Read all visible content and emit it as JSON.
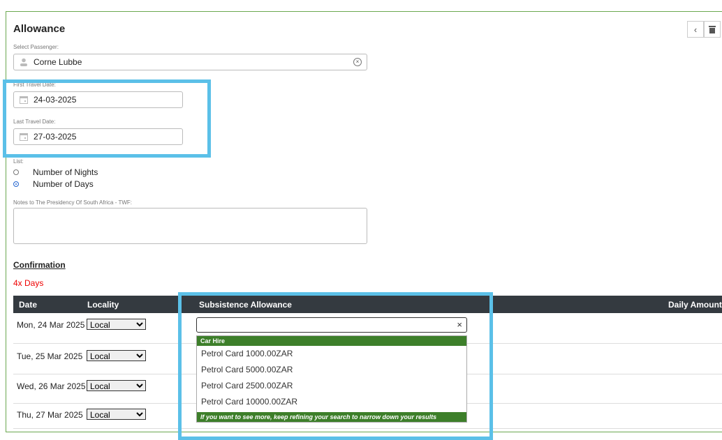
{
  "form": {
    "title": "Allowance",
    "passenger_label": "Select Passenger:",
    "passenger_value": "Corne Lubbe",
    "first_date_label": "First Travel Date:",
    "first_date_value": "24-03-2025",
    "last_date_label": "Last Travel Date:",
    "last_date_value": "27-03-2025",
    "list_label": "List:",
    "radio_nights": "Number of Nights",
    "radio_days": "Number of Days",
    "notes_label": "Notes to The Presidency Of South Africa - TWF:",
    "confirmation": "Confirmation",
    "days_count": "4x Days"
  },
  "table": {
    "headers": {
      "date": "Date",
      "locality": "Locality",
      "subsistence": "Subsistence Allowance",
      "daily": "Daily Amount"
    },
    "rows": [
      {
        "date": "Mon, 24 Mar 2025",
        "locality": "Local"
      },
      {
        "date": "Tue, 25 Mar 2025",
        "locality": "Local"
      },
      {
        "date": "Wed, 26 Mar 2025",
        "locality": "Local"
      },
      {
        "date": "Thu, 27 Mar 2025",
        "locality": "Local"
      }
    ]
  },
  "dropdown": {
    "group": "Car Hire",
    "options": [
      "Petrol Card 1000.00ZAR",
      "Petrol Card 5000.00ZAR",
      "Petrol Card 2500.00ZAR",
      "Petrol Card 10000.00ZAR"
    ],
    "note": "If you want to see more, keep refining your search to narrow down your results"
  },
  "colors": {
    "highlight": "#5bc0e8",
    "header_bg": "#343a40",
    "group_green": "#3d7f2a",
    "accent_red": "#e00000"
  },
  "icons": [
    "person-icon",
    "calendar-icon",
    "clear-icon",
    "chevron-left-icon",
    "trash-icon",
    "close-icon"
  ]
}
